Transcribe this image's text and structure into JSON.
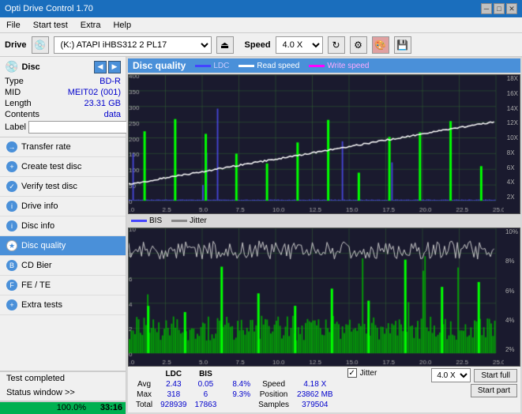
{
  "titleBar": {
    "title": "Opti Drive Control 1.70",
    "minBtn": "─",
    "maxBtn": "□",
    "closeBtn": "✕"
  },
  "menuBar": {
    "items": [
      "File",
      "Start test",
      "Extra",
      "Help"
    ]
  },
  "driveBar": {
    "label": "Drive",
    "driveValue": "(K:) ATAPI iHBS312  2 PL17",
    "speedLabel": "Speed",
    "speedValue": "4.0 X"
  },
  "disc": {
    "title": "Disc",
    "typeLabel": "Type",
    "typeValue": "BD-R",
    "midLabel": "MID",
    "midValue": "MEIT02 (001)",
    "lengthLabel": "Length",
    "lengthValue": "23.31 GB",
    "contentsLabel": "Contents",
    "contentsValue": "data",
    "labelLabel": "Label",
    "labelValue": ""
  },
  "navItems": [
    {
      "id": "transfer-rate",
      "label": "Transfer rate",
      "active": false
    },
    {
      "id": "create-test-disc",
      "label": "Create test disc",
      "active": false
    },
    {
      "id": "verify-test-disc",
      "label": "Verify test disc",
      "active": false
    },
    {
      "id": "drive-info",
      "label": "Drive info",
      "active": false
    },
    {
      "id": "disc-info",
      "label": "Disc info",
      "active": false
    },
    {
      "id": "disc-quality",
      "label": "Disc quality",
      "active": true
    },
    {
      "id": "cd-bier",
      "label": "CD Bier",
      "active": false
    },
    {
      "id": "fe-te",
      "label": "FE / TE",
      "active": false
    },
    {
      "id": "extra-tests",
      "label": "Extra tests",
      "active": false
    }
  ],
  "statusWindow": {
    "label": "Status window >>",
    "progressPercent": 100,
    "progressWidth": "100%",
    "progressTime": "33:16",
    "completedText": "Test completed"
  },
  "chartHeader": {
    "title": "Disc quality",
    "legend": [
      {
        "id": "ldc",
        "label": "LDC",
        "color": "#0000ff"
      },
      {
        "id": "read-speed",
        "label": "Read speed",
        "color": "#ffffff"
      },
      {
        "id": "write-speed",
        "label": "Write speed",
        "color": "#ff00ff"
      }
    ],
    "legend2": [
      {
        "id": "bis",
        "label": "BIS",
        "color": "#0000ff"
      },
      {
        "id": "jitter",
        "label": "Jitter",
        "color": "#ffffff"
      }
    ]
  },
  "stats": {
    "columns": [
      "",
      "LDC",
      "BIS",
      "",
      "Jitter",
      "Speed",
      ""
    ],
    "avg": {
      "label": "Avg",
      "ldc": "2.43",
      "bis": "0.05",
      "jitter": "8.4%",
      "speed": "4.18 X"
    },
    "max": {
      "label": "Max",
      "ldc": "318",
      "bis": "6",
      "jitter": "9.3%",
      "position": "23862 MB"
    },
    "total": {
      "label": "Total",
      "ldc": "928939",
      "bis": "17863",
      "samples": "379504"
    },
    "speedSelect": "4.0 X",
    "startFullLabel": "Start full",
    "startPartLabel": "Start part"
  }
}
